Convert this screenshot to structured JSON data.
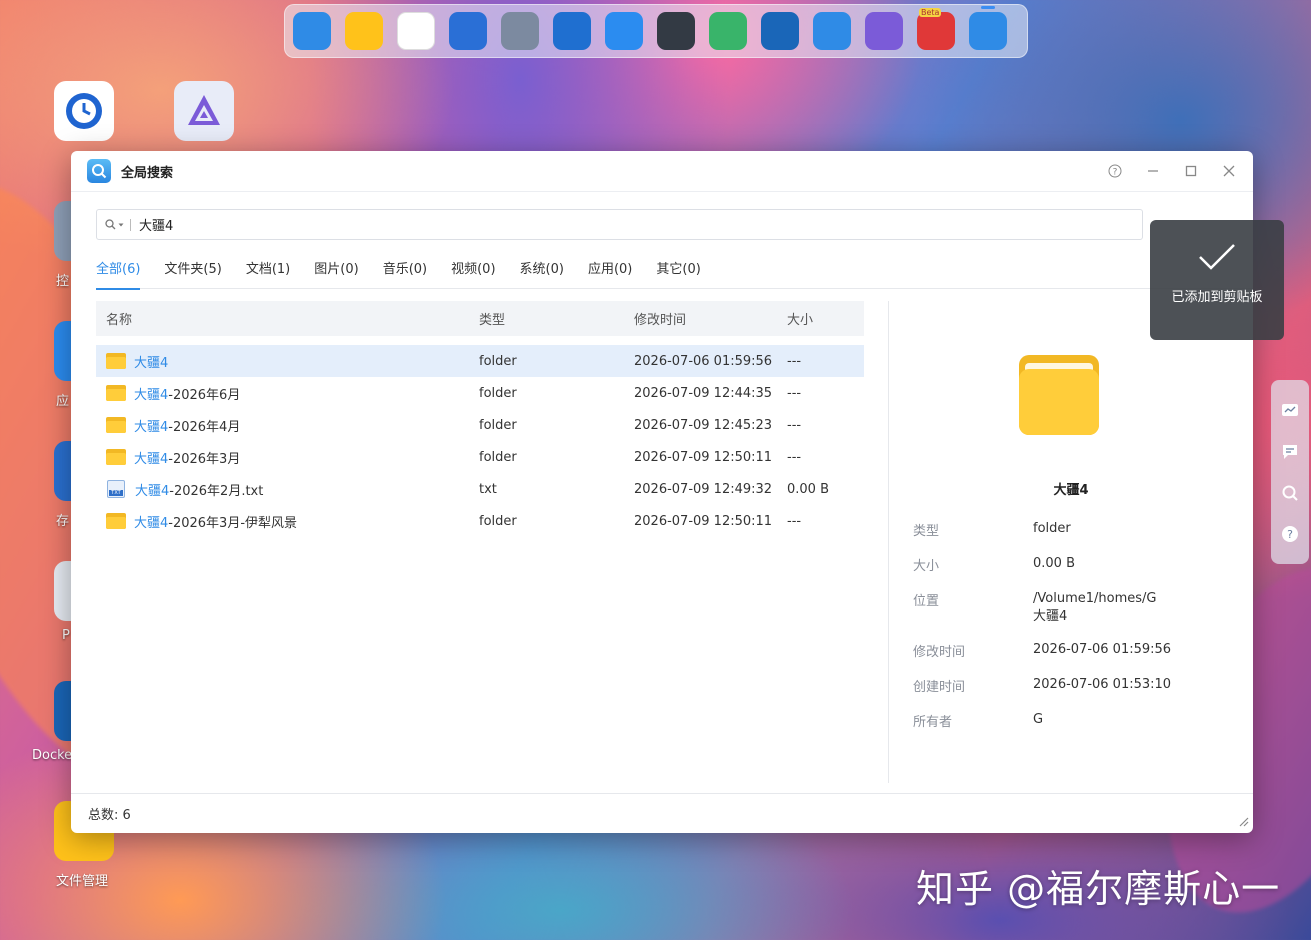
{
  "dock": {
    "items": [
      {
        "name": "dashboard-app-icon",
        "color": "#2f8be6"
      },
      {
        "name": "file-manager-app-icon",
        "color": "#ffc21a"
      },
      {
        "name": "app-center-icon",
        "color": "#ffffff"
      },
      {
        "name": "backup-app-icon",
        "color": "#2a6fd6"
      },
      {
        "name": "settings-app-icon",
        "color": "#7c8aa0"
      },
      {
        "name": "storage-app-icon",
        "color": "#1f6fd0"
      },
      {
        "name": "store-app-icon",
        "color": "#2b8cf0"
      },
      {
        "name": "terminal-app-icon",
        "color": "#333a44"
      },
      {
        "name": "security-app-icon",
        "color": "#39b46a"
      },
      {
        "name": "docker-app-icon",
        "color": "#1a66b8"
      },
      {
        "name": "support-app-icon",
        "color": "#2f8be6"
      },
      {
        "name": "jellyfin-app-icon",
        "color": "#7b5bd8"
      },
      {
        "name": "beta-app-icon",
        "color": "#e03838",
        "badge": "Beta"
      },
      {
        "name": "global-search-app-icon",
        "color": "#2f8be6"
      }
    ]
  },
  "desktop": {
    "labels": [
      "控",
      "应",
      "存",
      "P",
      "Docke",
      "文件管理"
    ]
  },
  "window": {
    "title": "全局搜索",
    "search": {
      "value": "大疆4"
    },
    "tabs": [
      "全部(6)",
      "文件夹(5)",
      "文档(1)",
      "图片(0)",
      "音乐(0)",
      "视频(0)",
      "系统(0)",
      "应用(0)",
      "其它(0)"
    ],
    "table": {
      "headers": {
        "name": "名称",
        "type": "类型",
        "time": "修改时间",
        "size": "大小"
      },
      "rows": [
        {
          "hl": "大疆4",
          "rest": "",
          "type": "folder",
          "time": "2026-07-06 01:59:56",
          "size": "---",
          "icon": "folder"
        },
        {
          "hl": "大疆4",
          "rest": "-2026年6月",
          "type": "folder",
          "time": "2026-07-09 12:44:35",
          "size": "---",
          "icon": "folder"
        },
        {
          "hl": "大疆4",
          "rest": "-2026年4月",
          "type": "folder",
          "time": "2026-07-09 12:45:23",
          "size": "---",
          "icon": "folder"
        },
        {
          "hl": "大疆4",
          "rest": "-2026年3月",
          "type": "folder",
          "time": "2026-07-09 12:50:11",
          "size": "---",
          "icon": "folder"
        },
        {
          "hl": "大疆4",
          "rest": "-2026年2月.txt",
          "type": "txt",
          "time": "2026-07-09 12:49:32",
          "size": "0.00 B",
          "icon": "txt"
        },
        {
          "hl": "大疆4",
          "rest": "-2026年3月-伊犁风景",
          "type": "folder",
          "time": "2026-07-09 12:50:11",
          "size": "---",
          "icon": "folder"
        }
      ]
    },
    "detail": {
      "name": "大疆4",
      "type_label": "类型",
      "type": "folder",
      "size_label": "大小",
      "size": "0.00 B",
      "location_label": "位置",
      "location_line1": "/Volume1/homes/G",
      "location_line2": "大疆4",
      "mtime_label": "修改时间",
      "mtime": "2026-07-06 01:59:56",
      "ctime_label": "创建时间",
      "ctime": "2026-07-06 01:53:10",
      "owner_label": "所有者",
      "owner": "G"
    },
    "status": "总数: 6"
  },
  "toast": {
    "message": "已添加到剪贴板"
  },
  "watermark": "知乎 @福尔摩斯心一"
}
